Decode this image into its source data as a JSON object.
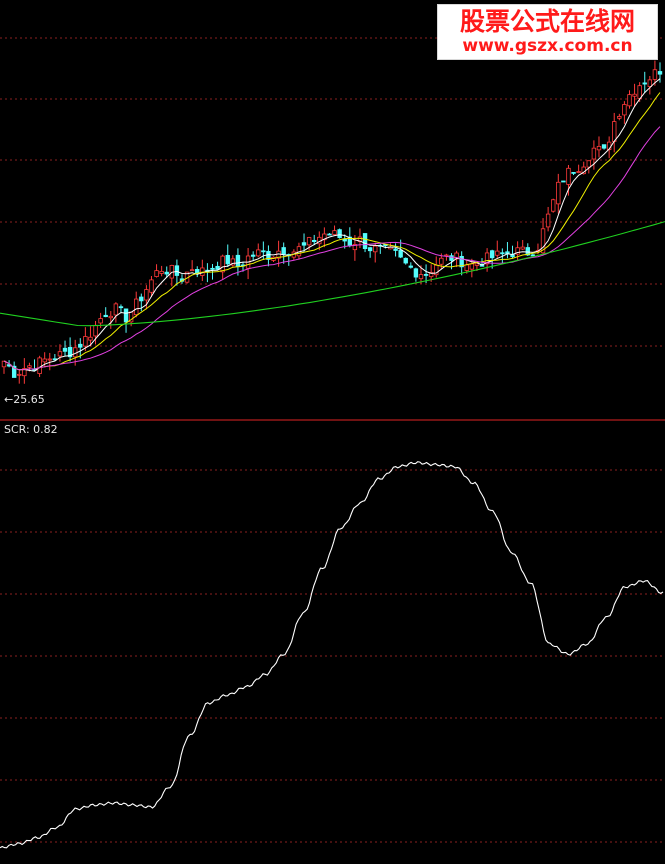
{
  "watermark": {
    "title_cn": "股票公式在线网",
    "url": "www.gszx.com.cn"
  },
  "colors": {
    "background": "#000000",
    "grid": "#8a1f1f",
    "divider": "#b41e1e",
    "candle_up": "#ff3a3a",
    "candle_down": "#54fcfc",
    "ma_fast": "#ffffff",
    "ma_mid": "#f0f000",
    "ma_slow": "#e040e0",
    "ma_long": "#20d020",
    "indicator_line": "#ffffff",
    "text": "#e8e8e8"
  },
  "chart_data": [
    {
      "type": "candlestick",
      "title": "",
      "low_marker_text": "←25.65",
      "low_marker_value": 25.65,
      "grid": true,
      "note_levels": "price axis unlabeled; trend path shown",
      "close_path": [
        27.2,
        26.3,
        26.8,
        27.0,
        27.4,
        27.6,
        27.9,
        28.5,
        29.4,
        30.6,
        30.9,
        30.3,
        31.3,
        32.6,
        33.8,
        33.6,
        33.1,
        33.9,
        33.5,
        34.0,
        34.4,
        33.9,
        34.6,
        34.9,
        34.7,
        35.2,
        35.0,
        35.3,
        35.9,
        36.3,
        36.1,
        35.6,
        35.8,
        35.2,
        35.0,
        34.9,
        34.1,
        33.6,
        33.4,
        34.2,
        34.6,
        34.4,
        34.0,
        34.3,
        34.6,
        34.8,
        35.0,
        34.9,
        35.3,
        37.6,
        39.9,
        40.8,
        41.2,
        42.3,
        42.0,
        44.5,
        45.9,
        46.8,
        47.3,
        47.9
      ]
    },
    {
      "type": "line",
      "title": "",
      "legend": "SCR: 0.82",
      "series": [
        {
          "name": "SCR",
          "values": [
            0.05,
            0.07,
            0.1,
            0.15,
            0.24,
            0.26,
            0.27,
            0.26,
            0.25,
            0.35,
            0.6,
            0.76,
            0.8,
            0.84,
            0.9,
            1.0,
            1.2,
            1.42,
            1.62,
            1.74,
            1.86,
            1.92,
            1.94,
            1.93,
            1.92,
            1.84,
            1.7,
            1.5,
            1.35,
            1.05,
            1.0,
            1.05,
            1.18,
            1.33,
            1.36,
            1.3
          ]
        }
      ],
      "current_value": 0.82,
      "grid": true
    }
  ]
}
